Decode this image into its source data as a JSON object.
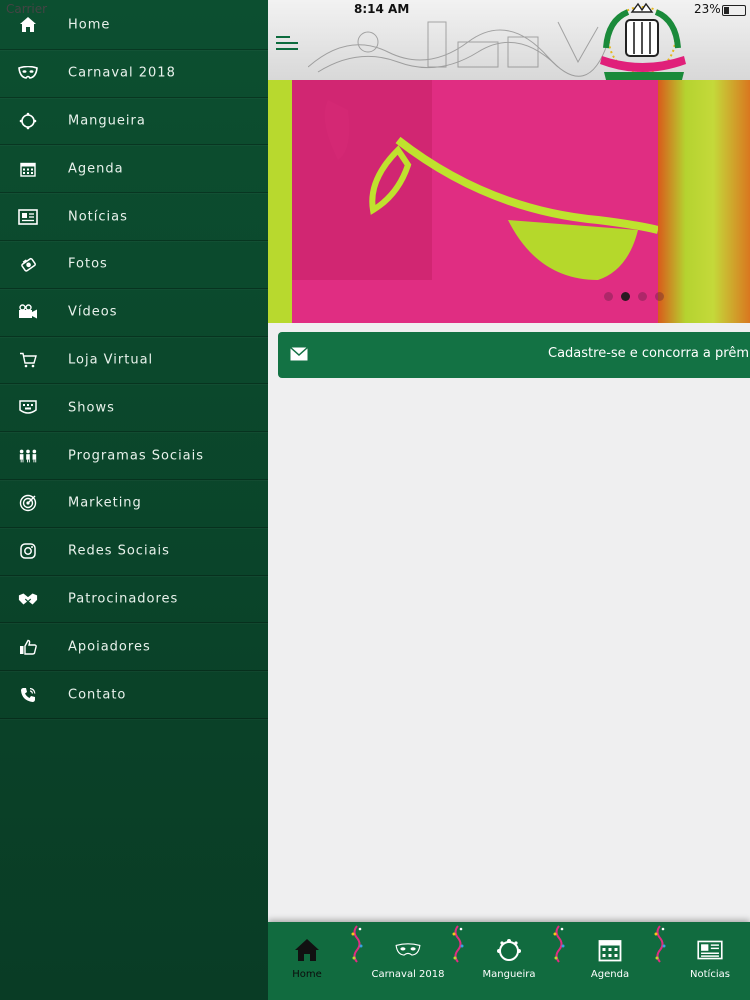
{
  "status_bar": {
    "carrier": "Carrier",
    "time": "8:14 AM",
    "battery": "23%"
  },
  "menu": {
    "items": [
      {
        "label": "Home",
        "icon": "home-icon"
      },
      {
        "label": "Carnaval 2018",
        "icon": "mask-icon"
      },
      {
        "label": "Mangueira",
        "icon": "tambourine-icon"
      },
      {
        "label": "Agenda",
        "icon": "calendar-icon"
      },
      {
        "label": "Notícias",
        "icon": "newspaper-icon"
      },
      {
        "label": "Fotos",
        "icon": "camera-icon"
      },
      {
        "label": "Vídeos",
        "icon": "video-camera-icon"
      },
      {
        "label": "Loja Virtual",
        "icon": "cart-icon"
      },
      {
        "label": "Shows",
        "icon": "ticket-icon"
      },
      {
        "label": "Programas Sociais",
        "icon": "people-icon"
      },
      {
        "label": "Marketing",
        "icon": "target-icon"
      },
      {
        "label": "Redes Sociais",
        "icon": "instagram-icon"
      },
      {
        "label": "Patrocinadores",
        "icon": "handshake-icon"
      },
      {
        "label": "Apoiadores",
        "icon": "thumbs-up-icon"
      },
      {
        "label": "Contato",
        "icon": "phone-icon"
      }
    ]
  },
  "banner": {
    "text": "Cadastre-se e concorra a prêmic"
  },
  "carousel": {
    "slide_count": 4,
    "active_index": 1
  },
  "tabbar": {
    "tabs": [
      {
        "label": "Home",
        "icon": "home-icon",
        "active": true
      },
      {
        "label": "Carnaval 2018",
        "icon": "mask-icon",
        "active": false
      },
      {
        "label": "Mangueira",
        "icon": "tambourine-icon",
        "active": false
      },
      {
        "label": "Agenda",
        "icon": "calendar-icon",
        "active": false
      },
      {
        "label": "Notícias",
        "icon": "newspaper-icon",
        "active": false
      }
    ]
  },
  "colors": {
    "menu_bg": "#0c4f30",
    "brand_green": "#137244",
    "accent_pink": "#e02d82"
  }
}
